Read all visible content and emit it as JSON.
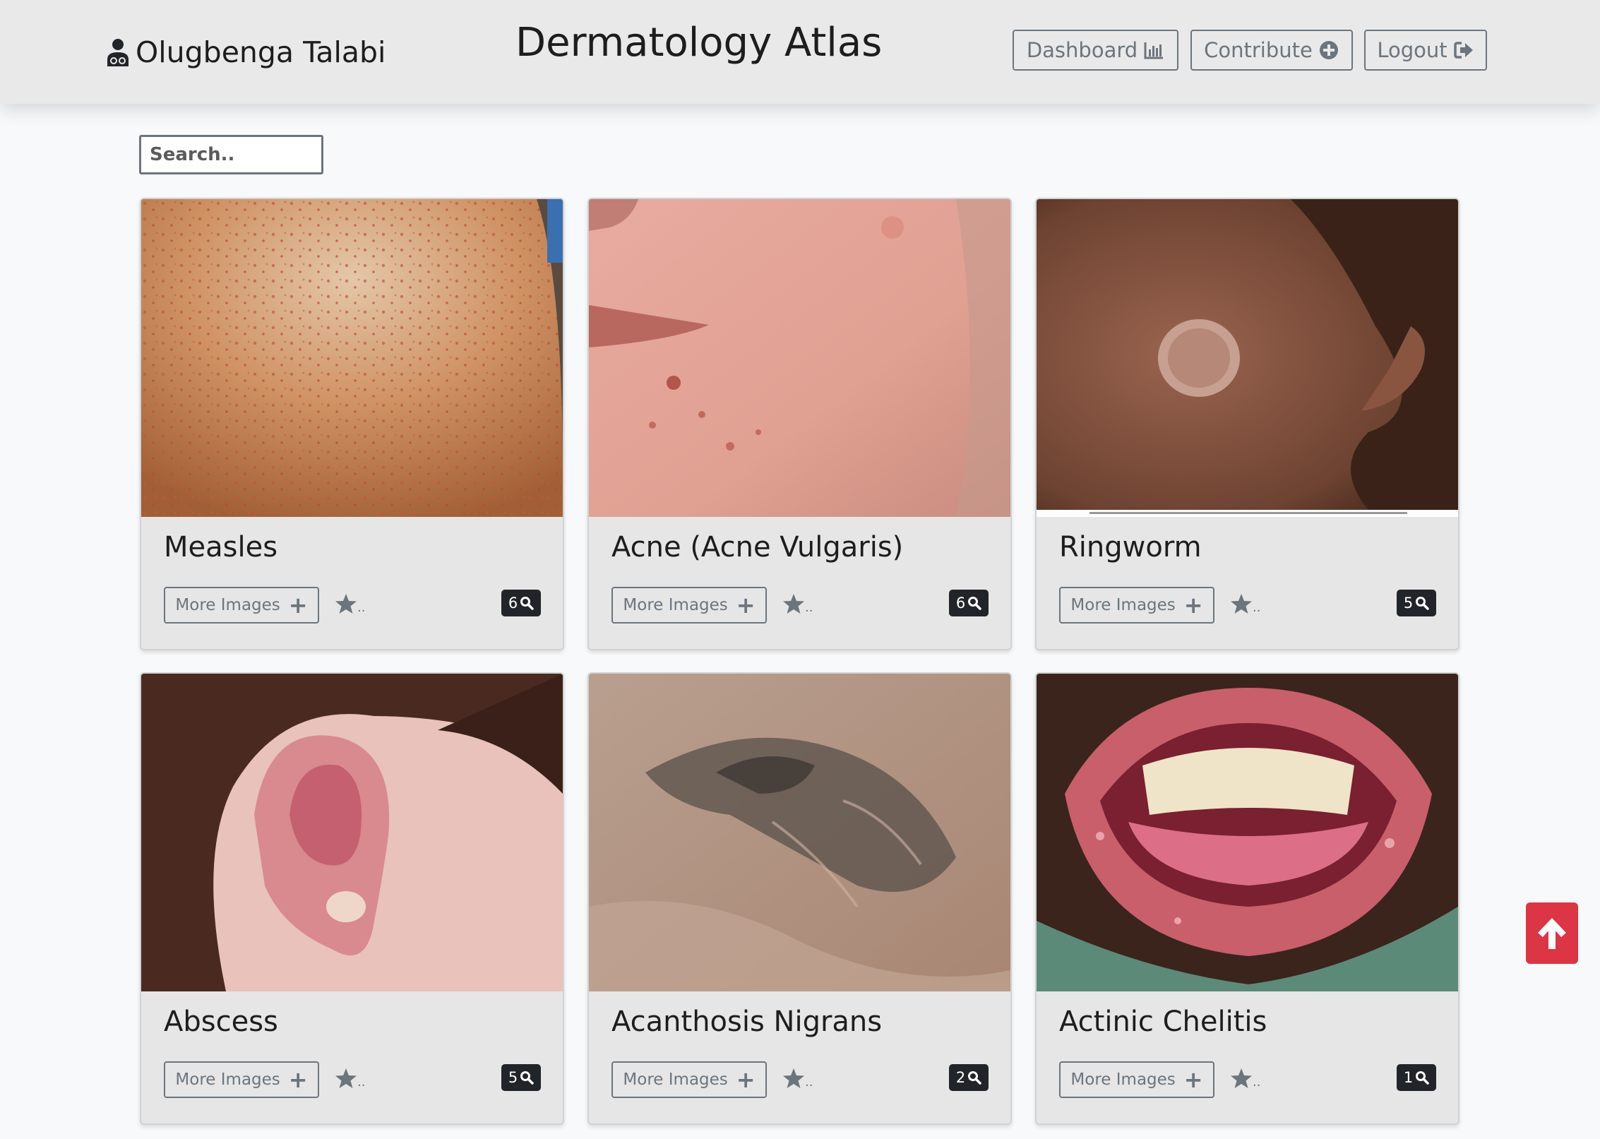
{
  "header": {
    "user_name": "Olugbenga Talabi",
    "user_icon": "user-doctor-icon",
    "brand": "Dermatology Atlas",
    "buttons": [
      {
        "label": "Dashboard",
        "icon": "chart-bar-icon"
      },
      {
        "label": "Contribute",
        "icon": "plus-circle-icon"
      },
      {
        "label": "Logout",
        "icon": "sign-out-icon"
      }
    ]
  },
  "search": {
    "placeholder": "Search.."
  },
  "cards": [
    {
      "title": "Measles",
      "more_label": "More Images",
      "star_suffix": "..",
      "count": "6"
    },
    {
      "title": "Acne (Acne Vulgaris)",
      "more_label": "More Images",
      "star_suffix": "..",
      "count": "6"
    },
    {
      "title": "Ringworm",
      "more_label": "More Images",
      "star_suffix": "..",
      "count": "5"
    },
    {
      "title": "Abscess",
      "more_label": "More Images",
      "star_suffix": "..",
      "count": "5"
    },
    {
      "title": "Acanthosis Nigrans",
      "more_label": "More Images",
      "star_suffix": "..",
      "count": "2"
    },
    {
      "title": "Actinic Chelitis",
      "more_label": "More Images",
      "star_suffix": "..",
      "count": "1"
    }
  ],
  "colors": {
    "navbar_bg": "#e9e9e9",
    "page_bg": "#f8f9fa",
    "card_bg": "#e6e6e6",
    "outline_secondary": "#6c757d",
    "badge_bg": "#212529",
    "back_to_top": "#dc3545"
  },
  "back_to_top_icon": "arrow-up-icon"
}
